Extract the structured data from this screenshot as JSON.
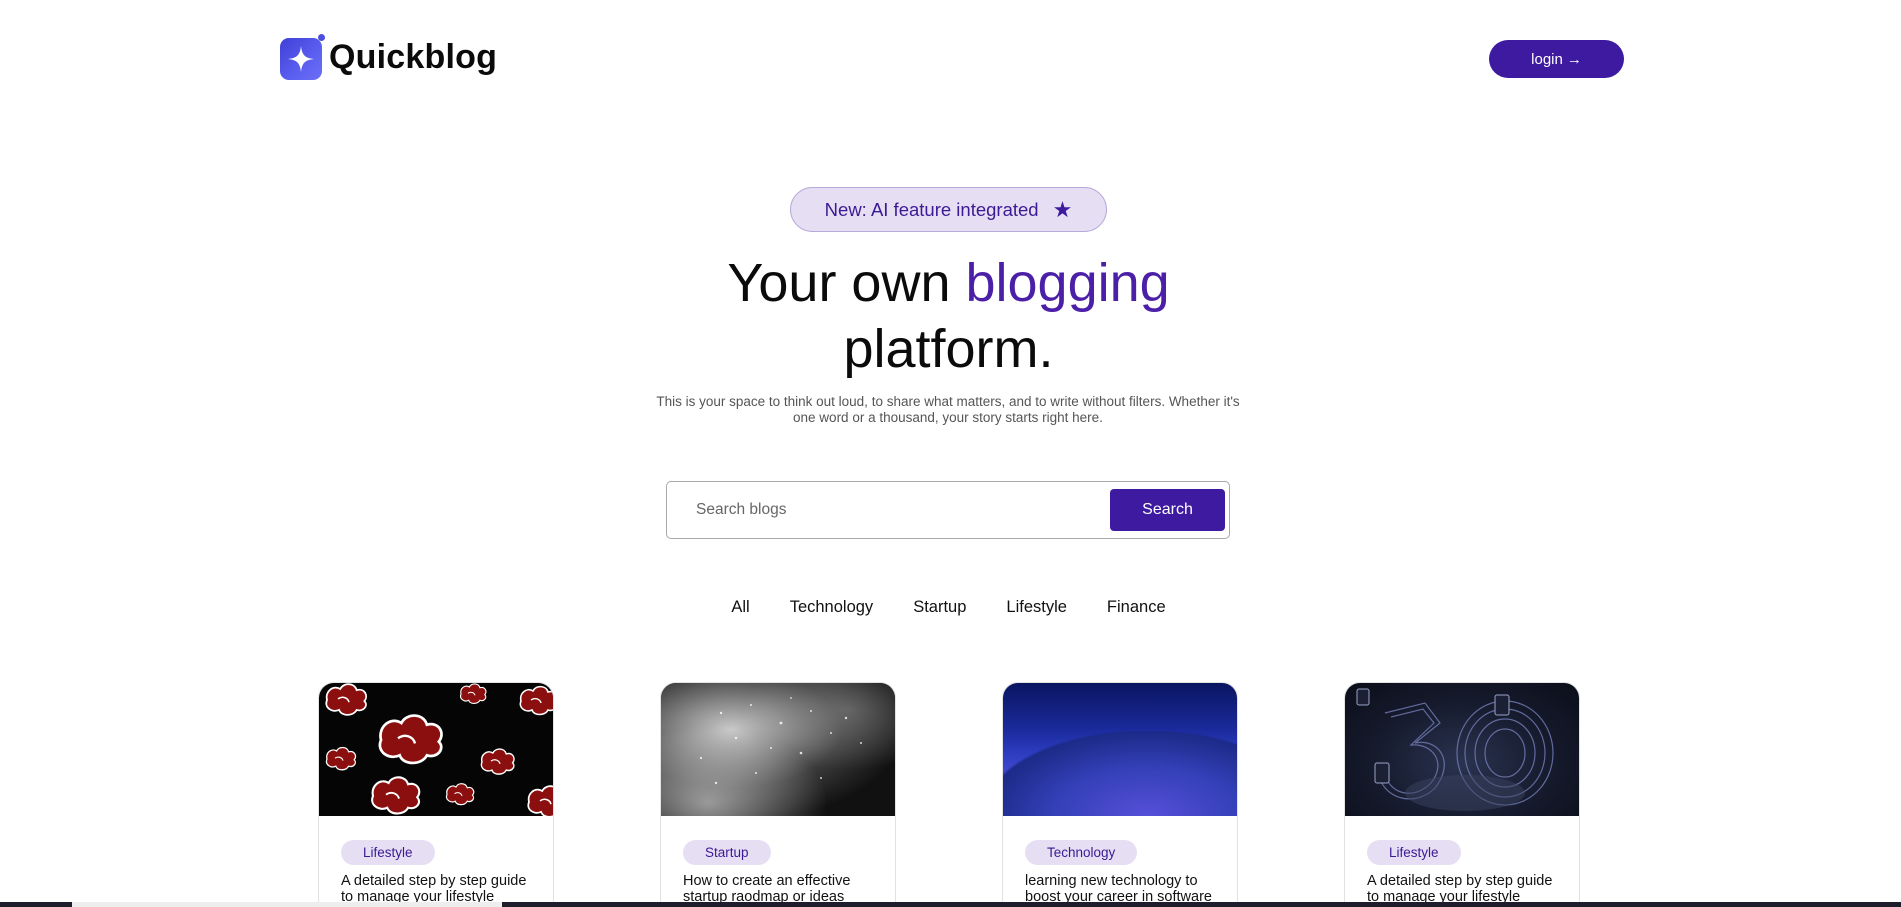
{
  "header": {
    "brand": "Quickblog",
    "login_label": "login"
  },
  "hero": {
    "badge_text": "New: AI feature integrated",
    "headline_pre": "Your own ",
    "headline_accent": "blogging",
    "headline_post": "platform.",
    "subtext": "This is your space to think out loud, to share what matters, and to write without filters. Whether it's one word or a thousand, your story starts right here."
  },
  "search": {
    "placeholder": "Search blogs",
    "button_label": "Search"
  },
  "categories": [
    "All",
    "Technology",
    "Startup",
    "Lifestyle",
    "Finance"
  ],
  "cards": [
    {
      "tag": "Lifestyle",
      "title": "A detailed step by step guide to manage your lifestyle",
      "image": "red-clouds-pattern"
    },
    {
      "tag": "Startup",
      "title": "How to create an effective startup raodmap or ideas",
      "image": "grey-particles"
    },
    {
      "tag": "Technology",
      "title": "learning new technology to boost your career in software",
      "image": "blue-landscape"
    },
    {
      "tag": "Lifestyle",
      "title": "A detailed step by step guide to manage your lifestyle",
      "image": "dark-3d-numbers"
    }
  ],
  "colors": {
    "brand_purple": "#3d1aa0",
    "accent_text": "#4b1fa8",
    "pill_bg": "#e6dff3"
  }
}
